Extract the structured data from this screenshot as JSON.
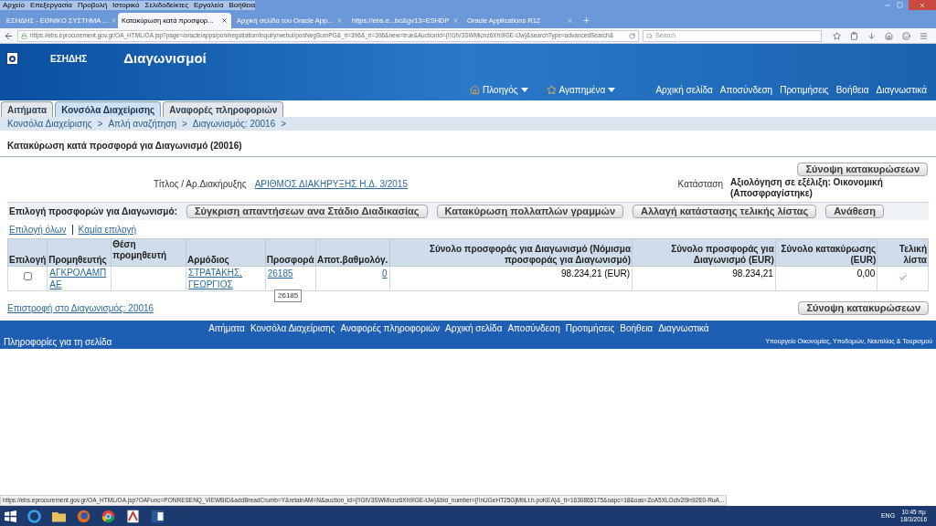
{
  "browser": {
    "menu": [
      "Αρχείο",
      "Επεξεργασία",
      "Προβολή",
      "Ιστορικό",
      "Σελιδοδείκτες",
      "Εργαλεία",
      "Βοήθεια"
    ],
    "tabs": [
      {
        "label": "ΕΣΗΔΗΣ - ΕΘΝΙΚΟ ΣΥΣΤΗΜΑ ...",
        "selected": false
      },
      {
        "label": "Κατακύρωση κατά προσφορ...",
        "selected": true
      },
      {
        "label": "Αρχική σελίδα του Oracle App...",
        "selected": false
      },
      {
        "label": "https://ebs.e...bc&gv13=ESHDP",
        "selected": false
      },
      {
        "label": "Oracle Applications R12",
        "selected": false
      }
    ],
    "url": "https://ebs.eprocurement.gov.gr/OA_HTML/OA.jsp?page=/oracle/apps/pon/negotiation/inquiry/webui/ponNegSumPG&_ri=396&_ri=396&new=true&AuctionId={!!GtV3SWMicnz6Xh9IGE-tJw}&searchType=advancedSearch&",
    "search_placeholder": "Search",
    "status_url": "https://ebs.eprocurement.gov.gr/OA_HTML/OA.jsp?OAFunc=PONRESENQ_VIEWBID&addBreadCrumb=Y&retainAM=N&auction_id={!!GtV3SWMicnz6Xh9IGE-tJw}&bid_number={!!nUGeHT25GjMbLt.h.poKEA}&_ti=1630865175&oapc=18&oas=ZoA5XLOclv2i9n92E0-RuA..."
  },
  "app": {
    "org": "ΕΣΗΔΗΣ",
    "title": "Διαγωνισμοί",
    "menus": [
      "Πλοηγός",
      "Αγαπημένα"
    ],
    "global_links": [
      "Αρχική σελίδα",
      "Αποσύνδεση",
      "Προτιμήσεις",
      "Βοήθεια",
      "Διαγνωστικά"
    ],
    "tabs": [
      {
        "label": "Αιτήματα",
        "selected": false
      },
      {
        "label": "Κονσόλα Διαχείρισης",
        "selected": true
      },
      {
        "label": "Αναφορές πληροφοριών",
        "selected": false
      }
    ],
    "breadcrumbs": [
      "Κονσόλα Διαχείρισης",
      "Απλή αναζήτηση",
      "Διαγωνισμός: 20016"
    ],
    "breadcrumb_separator": ">",
    "page_title": "Κατακύρωση κατά προσφορά για Διαγωνισμό (20016)",
    "summary_button": "Σύνοψη κατακυρώσεων",
    "title_label": "Τίτλος / Αρ.Διακήρυξης",
    "title_value": "ΑΡΙΘΜΟΣ ΔΙΑΚΗΡΥΞΗΣ Η.Δ. 3/2015",
    "status_label": "Κατάσταση",
    "status_value": "Αξιολόγηση σε εξέλιξη: Οικονομική (Αποσφραγίστηκε)",
    "selection_label": "Επιλογή προσφορών για Διαγωνισμό:",
    "action_buttons": [
      "Σύγκριση απαντήσεων ανα Στάδιο Διαδικασίας",
      "Κατακύρωση πολλαπλών γραμμών",
      "Αλλαγή κατάστασης τελικής λίστας",
      "Ανάθεση"
    ],
    "select_all": "Επιλογή όλων",
    "select_none": "Καμία επιλογή",
    "columns": [
      "Επιλογή",
      "Προμηθευτής",
      "Θέση προμηθευτή",
      "Αρμόδιος",
      "Προσφορά",
      "Αποτ.βαθμολόγ.",
      "Σύνολο προσφοράς για Διαγωνισμό (Νόμισμα προσφοράς για Διαγωνισμό)",
      "Σύνολο προσφοράς για Διαγωνισμό (EUR)",
      "Σύνολο κατακύρωσης (EUR)",
      "Τελική λίστα"
    ],
    "rows": [
      {
        "checked": false,
        "supplier": "ΑΓΚΡΟΛΑΜΠ ΑΕ",
        "officer": "ΣΤΡΑΤΑΚΗΣ, ΓΕΩΡΓΙΟΣ",
        "offer": "26185",
        "score": "0",
        "total_offer": "98.234,21 (EUR)",
        "total_eur": "98.234,21",
        "total_award": "0,00",
        "final_list": true
      }
    ],
    "tooltip": "26185",
    "return_link": "Επιστροφή στο Διαγωνισμός: 20016",
    "summary_button_bottom": "Σύνοψη κατακυρώσεων",
    "footer_links": [
      "Αιτήματα",
      "Κονσόλα Διαχείρισης",
      "Αναφορές πληροφοριών",
      "Αρχική σελίδα",
      "Αποσύνδεση",
      "Προτιμήσεις",
      "Βοήθεια",
      "Διαγνωστικά"
    ],
    "footer_info": "Πληροφορίες για τη σελίδα",
    "footer_ministry": "Υπουργείο Οικονομίας, Υποδομών, Ναυτιλίας & Τουρισμού"
  },
  "taskbar": {
    "language": "ENG",
    "time": "10:45 πμ",
    "date": "18/3/2016"
  }
}
